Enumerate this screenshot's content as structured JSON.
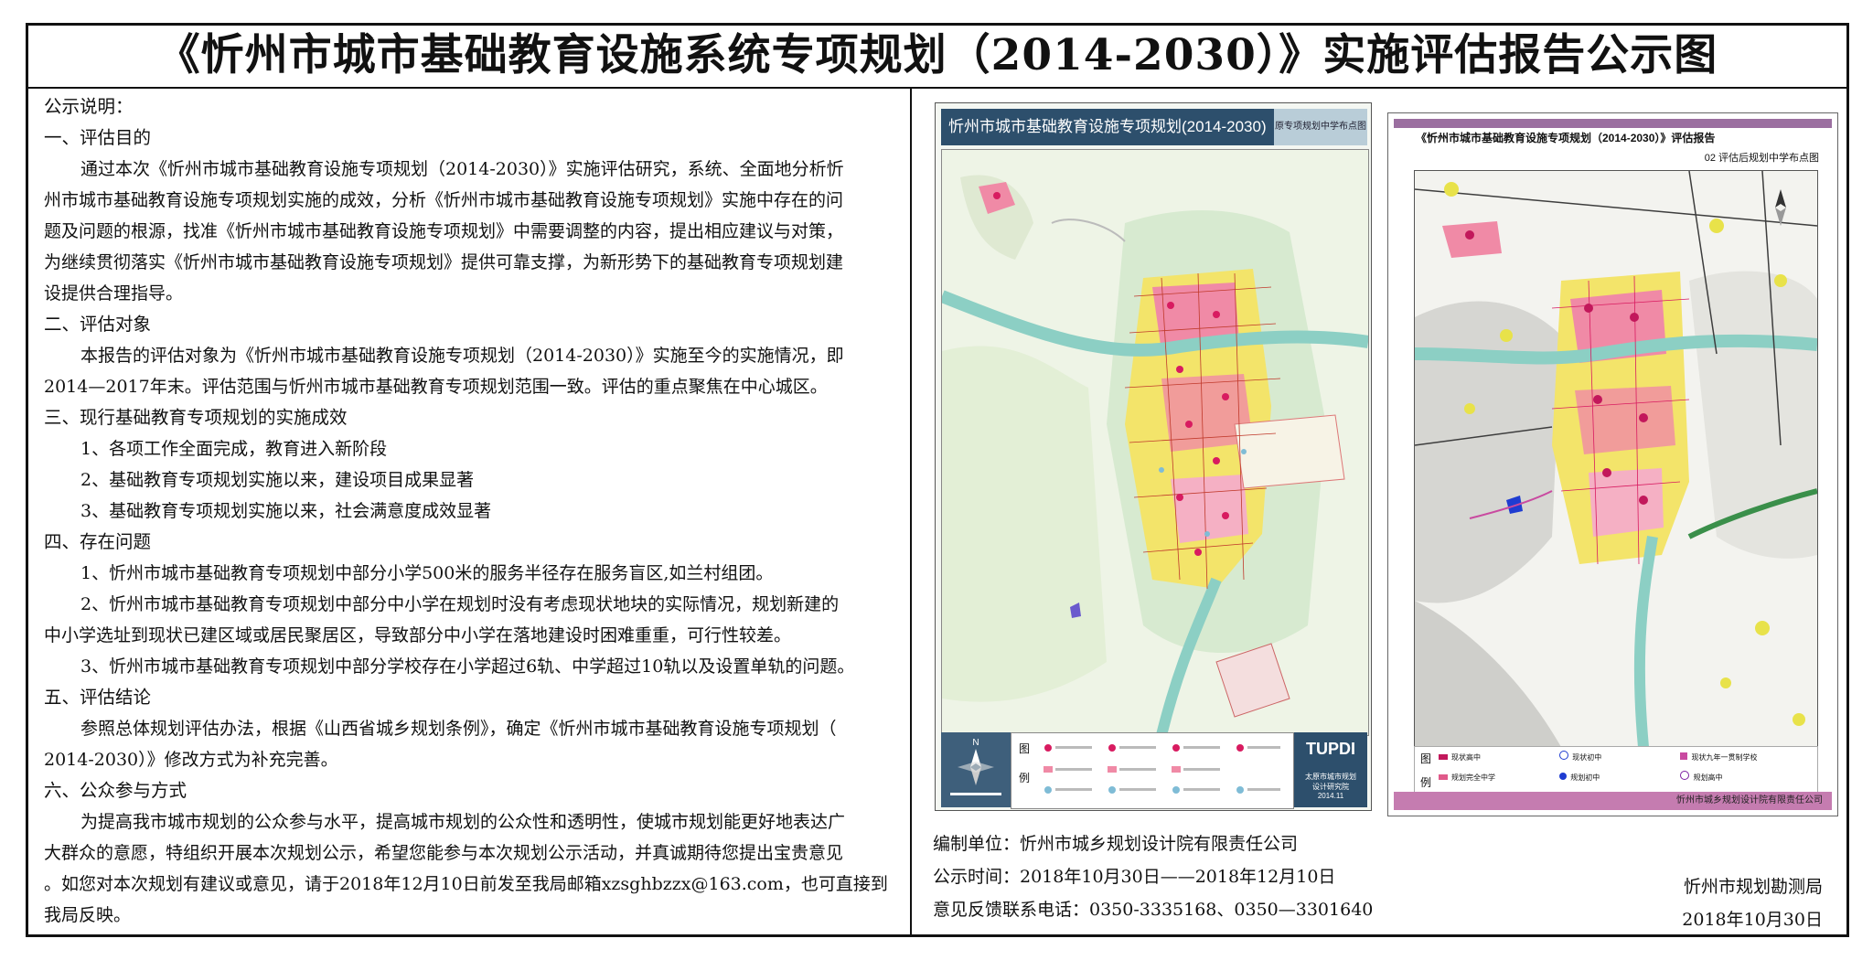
{
  "title": "《忻州市城市基础教育设施系统专项规划（2014-2030）》实施评估报告公示图",
  "notice": {
    "heading": "公示说明：",
    "lines": [
      {
        "t": "一、评估目的",
        "c": "sect"
      },
      {
        "t": "通过本次《忻州市城市基础教育设施专项规划（2014-2030）》实施评估研究，系统、全面地分析忻",
        "c": "p indent1"
      },
      {
        "t": "州市城市基础教育设施专项规划实施的成效，分析《忻州市城市基础教育设施专项规划》实施中存在的问",
        "c": "p"
      },
      {
        "t": "题及问题的根源，找准《忻州市城市基础教育设施专项规划》中需要调整的内容，提出相应建议与对策，",
        "c": "p"
      },
      {
        "t": "为继续贯彻落实《忻州市城市基础教育设施专项规划》提供可靠支撑，为新形势下的基础教育专项规划建",
        "c": "p"
      },
      {
        "t": "设提供合理指导。",
        "c": "p"
      },
      {
        "t": "二、评估对象",
        "c": "sect"
      },
      {
        "t": "本报告的评估对象为《忻州市城市基础教育设施专项规划（2014-2030）》实施至今的实施情况，即",
        "c": "p indent1"
      },
      {
        "t": "2014—2017年末。评估范围与忻州市城市基础教育专项规划范围一致。评估的重点聚焦在中心城区。",
        "c": "p"
      },
      {
        "t": "三、现行基础教育专项规划的实施成效",
        "c": "sect"
      },
      {
        "t": "1、各项工作全面完成，教育进入新阶段",
        "c": "p indent2"
      },
      {
        "t": "2、基础教育专项规划实施以来，建设项目成果显著",
        "c": "p indent2"
      },
      {
        "t": "3、基础教育专项规划实施以来，社会满意度成效显著",
        "c": "p indent2"
      },
      {
        "t": "四、存在问题",
        "c": "sect"
      },
      {
        "t": "1、忻州市城市基础教育专项规划中部分小学500米的服务半径存在服务盲区,如兰村组团。",
        "c": "p indent2"
      },
      {
        "t": "2、忻州市城市基础教育专项规划中部分中小学在规划时没有考虑现状地块的实际情况，规划新建的",
        "c": "p indent2"
      },
      {
        "t": "中小学选址到现状已建区域或居民聚居区，导致部分中小学在落地建设时困难重重，可行性较差。",
        "c": "p"
      },
      {
        "t": "3、忻州市城市基础教育专项规划中部分学校存在小学超过6轨、中学超过10轨以及设置单轨的问题。",
        "c": "p indent2"
      },
      {
        "t": "五、评估结论",
        "c": "sect"
      },
      {
        "t": "参照总体规划评估办法，根据《山西省城乡规划条例》，确定《忻州市城市基础教育设施专项规划（",
        "c": "p indent1"
      },
      {
        "t": "2014-2030）》修改方式为补充完善。",
        "c": "p"
      },
      {
        "t": "六、公众参与方式",
        "c": "sect"
      },
      {
        "t": "为提高我市城市规划的公众参与水平，提高城市规划的公众性和透明性，使城市规划能更好地表达广",
        "c": "p indent1"
      },
      {
        "t": "大群众的意愿，特组织开展本次规划公示，希望您能参与本次规划公示活动，并真诚期待您提出宝贵意见",
        "c": "p"
      },
      {
        "t": "。如您对本次规划有建议或意见，请于2018年12月10日前发至我局邮箱xzsghbzzx@163.com，也可直接到",
        "c": "p"
      },
      {
        "t": "我局反映。",
        "c": "p"
      }
    ]
  },
  "map1": {
    "header": "忻州市城市基础教育设施专项规划(2014-2030)",
    "subheader": "原专项规划中学布点图",
    "legend_title_1": "图",
    "legend_title_2": "例",
    "logo": "TUPDI",
    "logo_sub1": "太原市城市规划",
    "logo_sub2": "设计研究院",
    "logo_date": "2014.11"
  },
  "map2": {
    "title": "《忻州市城市基础教育设施专项规划（2014-2030）》评估报告",
    "subtitle": "02 评估后规划中学布点图",
    "legend_title_1": "图",
    "legend_title_2": "例",
    "legend_items": [
      "现状高中",
      "现状初中",
      "现状九年一贯制学校",
      "规划完全中学",
      "规划初中",
      "规划高中"
    ],
    "footer": "忻州市城乡规划设计院有限责任公司"
  },
  "bottom": {
    "unit": "编制单位：忻州市城乡规划设计院有限责任公司",
    "time": "公示时间：2018年10月30日——2018年12月10日",
    "phone": "意见反馈联系电话：0350-3335168、0350—3301640"
  },
  "issuer": {
    "name": "忻州市规划勘测局",
    "date": "2018年10月30日"
  },
  "colors": {
    "map1_header_bg": "#2d4f6c",
    "map2_footer": "#c57cb0",
    "urban_yellow": "#f3e46a",
    "urban_pink": "#f08aa6",
    "river": "#8ccfc4"
  }
}
